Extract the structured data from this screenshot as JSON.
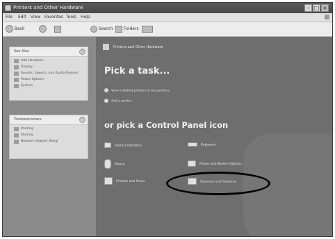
{
  "window": {
    "title": "Printers and Other Hardware"
  },
  "menu": [
    "File",
    "Edit",
    "View",
    "Favorites",
    "Tools",
    "Help"
  ],
  "toolbar": {
    "back": "Back",
    "search": "Search",
    "folders": "Folders"
  },
  "left_panels": [
    {
      "heading": "See Also",
      "links": [
        "Add Hardware",
        "Display",
        "Sounds, Speech, and Audio Devices",
        "Power Options",
        "System"
      ]
    },
    {
      "heading": "Troubleshooters",
      "links": [
        "Printing",
        "Sharing",
        "Network Adapter Setup"
      ]
    }
  ],
  "main": {
    "header": "Printers and Other Hardware",
    "pick_task": "Pick a task...",
    "tasks": [
      "View installed printers or fax printers",
      "Add a printer"
    ],
    "pick_icon": "or pick a Control Panel icon",
    "categories": [
      "Game Controllers",
      "Keyboard",
      "Mouse",
      "Phone and Modem Options",
      "Printers and Faxes",
      "Scanners and Cameras"
    ]
  }
}
